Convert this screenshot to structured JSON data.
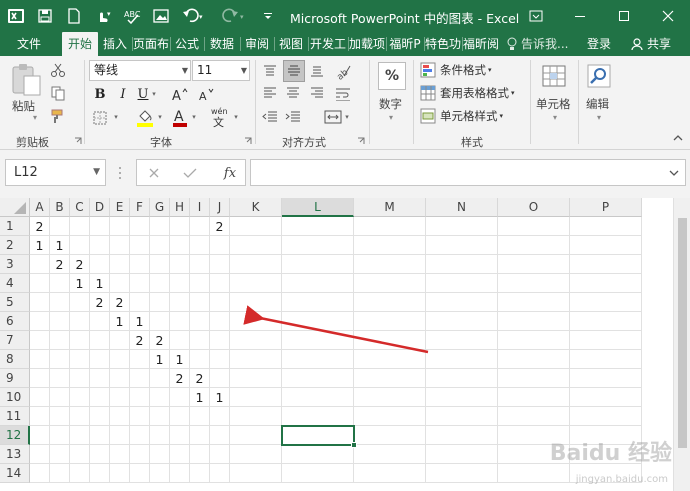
{
  "window": {
    "title": "Microsoft PowerPoint 中的图表 - Excel"
  },
  "tabs": [
    "文件",
    "开始",
    "插入",
    "页面布",
    "公式",
    "数据",
    "审阅",
    "视图",
    "开发工",
    "加载项",
    "福昕P",
    "特色功",
    "福昕阅"
  ],
  "active_tab": "开始",
  "tell_me": "告诉我...",
  "signin": "登录",
  "share": "共享",
  "ribbon": {
    "clipboard": {
      "paste": "粘贴",
      "label": "剪贴板"
    },
    "font": {
      "name": "等线",
      "size": "11",
      "label": "字体",
      "phonetic": "wén"
    },
    "alignment": {
      "label": "对齐方式"
    },
    "number": {
      "button": "数字",
      "icon_text": "%"
    },
    "styles": {
      "label": "样式",
      "conditional": "条件格式",
      "table": "套用表格格式",
      "cell_styles": "单元格样式"
    },
    "cells": {
      "button": "单元格"
    },
    "editing": {
      "button": "编辑"
    }
  },
  "formula_bar": {
    "name_box": "L12",
    "formula": "",
    "fx": "fx"
  },
  "sheet": {
    "columns": [
      "A",
      "B",
      "C",
      "D",
      "E",
      "F",
      "G",
      "H",
      "I",
      "J",
      "K",
      "L",
      "M",
      "N",
      "O",
      "P"
    ],
    "rows": [
      "1",
      "2",
      "3",
      "4",
      "5",
      "6",
      "7",
      "8",
      "9",
      "10",
      "11",
      "12",
      "13",
      "14"
    ],
    "selected_cell": "L12",
    "selected_column": "L",
    "selected_row": "12",
    "cells": [
      {
        "ref": "A1",
        "value": "2"
      },
      {
        "ref": "J1",
        "value": "2"
      },
      {
        "ref": "A2",
        "value": "1"
      },
      {
        "ref": "B2",
        "value": "1"
      },
      {
        "ref": "B3",
        "value": "2"
      },
      {
        "ref": "C3",
        "value": "2"
      },
      {
        "ref": "C4",
        "value": "1"
      },
      {
        "ref": "D4",
        "value": "1"
      },
      {
        "ref": "D5",
        "value": "2"
      },
      {
        "ref": "E5",
        "value": "2"
      },
      {
        "ref": "E6",
        "value": "1"
      },
      {
        "ref": "F6",
        "value": "1"
      },
      {
        "ref": "F7",
        "value": "2"
      },
      {
        "ref": "G7",
        "value": "2"
      },
      {
        "ref": "G8",
        "value": "1"
      },
      {
        "ref": "H8",
        "value": "1"
      },
      {
        "ref": "H9",
        "value": "2"
      },
      {
        "ref": "I9",
        "value": "2"
      },
      {
        "ref": "I10",
        "value": "1"
      },
      {
        "ref": "J10",
        "value": "1"
      }
    ]
  },
  "watermark": {
    "text": "Baidu 经验",
    "sub": "jingyan.baidu.com"
  },
  "colors": {
    "excel_green": "#217346",
    "arrow": "#d42a2a",
    "font_red": "#c00000",
    "highlight_yellow": "#ffff00"
  }
}
